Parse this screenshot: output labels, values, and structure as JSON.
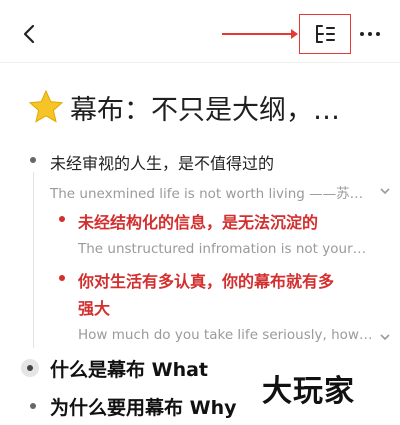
{
  "title": "幕布：不只是大纲，…",
  "items": {
    "a": "未经审视的人生，是不值得过的",
    "a_note": "The unexmined life is not worth living ——苏…",
    "b": "未经结构化的信息，是无法沉淀的",
    "b_note": "The unstructured infromation is not your…",
    "c1": "你对生活有多认真，你的幕布就有多",
    "c2": "强大",
    "c_note": "How much do you take life seriously, how…",
    "h1": "什么是幕布 What",
    "h2": "为什么要用幕布 Why"
  },
  "watermark": "大玩家",
  "colors": {
    "accent_red": "#d32f2f",
    "note_gray": "#9a9a9a",
    "star": "#f6c426"
  },
  "icons": {
    "back": "back-arrow-icon",
    "outline": "outline-list-icon",
    "more": "more-icon",
    "star": "star-icon"
  }
}
